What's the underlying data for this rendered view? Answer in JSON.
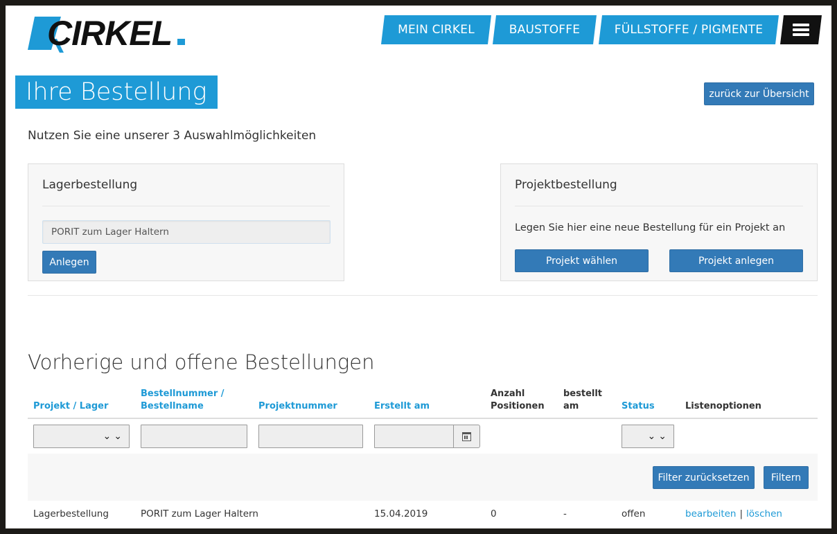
{
  "brand": {
    "logo_text": "CIRKEL",
    "colors": {
      "accent": "#1e9ad6",
      "button": "#337ab7",
      "dark": "#111111"
    }
  },
  "nav": {
    "items": [
      {
        "label": "MEIN CIRKEL"
      },
      {
        "label": "BAUSTOFFE"
      },
      {
        "label": "FÜLLSTOFFE / PIGMENTE"
      }
    ],
    "menu_icon": "hamburger-menu-icon"
  },
  "page": {
    "title": "Ihre Bestellung",
    "back_label": "zurück zur Übersicht",
    "intro": "Nutzen Sie eine unserer 3 Auswahlmöglichkeiten"
  },
  "lager": {
    "title": "Lagerbestellung",
    "input_value": "PORIT zum Lager Haltern",
    "button_label": "Anlegen"
  },
  "projekt": {
    "title": "Projektbestellung",
    "text": "Legen Sie hier eine neue Bestellung für ein Projekt an",
    "choose_label": "Projekt wählen",
    "create_label": "Projekt anlegen"
  },
  "orders": {
    "title": "Vorherige und offene Bestellungen",
    "columns": [
      {
        "line1": "Projekt / Lager",
        "line2": "",
        "sortable": true
      },
      {
        "line1": "Bestellnummer /",
        "line2": "Bestellname",
        "sortable": true
      },
      {
        "line1": "Projektnummer",
        "line2": "",
        "sortable": true
      },
      {
        "line1": "Erstellt am",
        "line2": "",
        "sortable": true
      },
      {
        "line1": "Anzahl",
        "line2": "Positionen",
        "sortable": false
      },
      {
        "line1": "bestellt",
        "line2": "am",
        "sortable": false
      },
      {
        "line1": "Status",
        "line2": "",
        "sortable": true
      },
      {
        "line1": "Listenoptionen",
        "line2": "",
        "sortable": false
      }
    ],
    "filter": {
      "reset_label": "Filter zurücksetzen",
      "apply_label": "Filtern",
      "calendar_icon": "calendar-icon"
    },
    "rows": [
      {
        "projekt_lager": "Lagerbestellung",
        "bestellname": "PORIT zum Lager Haltern",
        "projektnummer": "",
        "erstellt_am": "15.04.2019",
        "anzahl_positionen": "0",
        "bestellt_am": "-",
        "status": "offen",
        "edit_label": "bearbeiten",
        "separator": "|",
        "delete_label": "löschen"
      }
    ]
  }
}
